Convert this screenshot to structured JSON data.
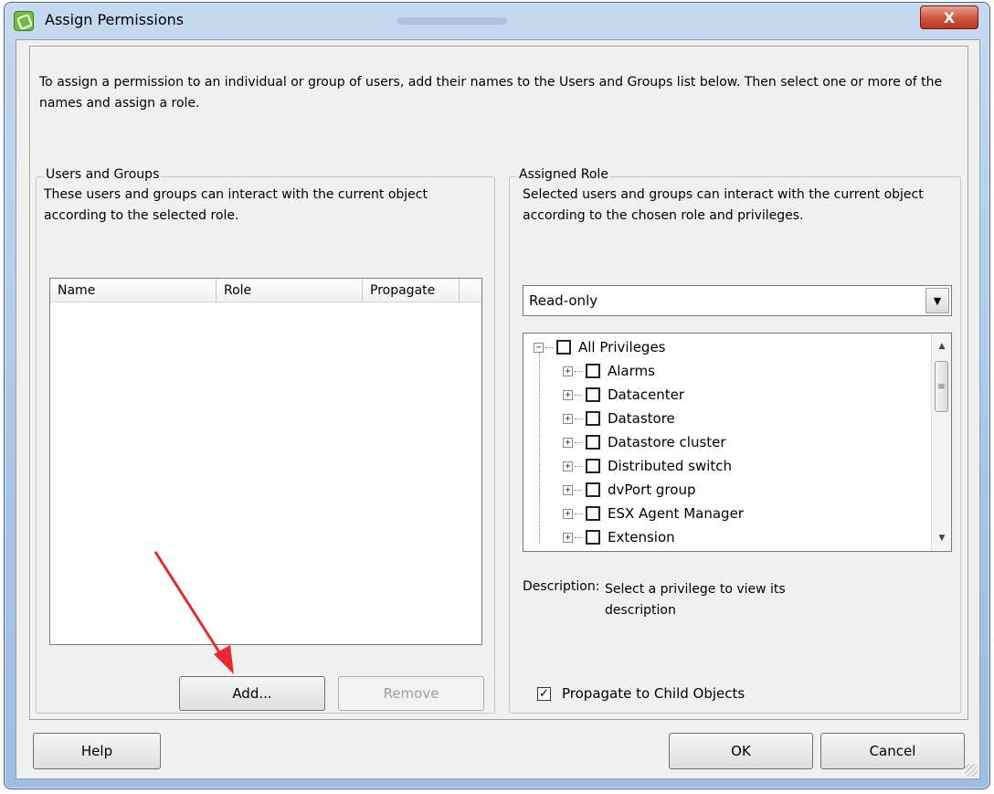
{
  "window": {
    "title": "Assign Permissions",
    "close_label": "X"
  },
  "intro": "To assign a permission to an individual or group of users, add their names to the Users and Groups list below. Then select one or more of the names and assign a role.",
  "users_groups": {
    "legend": "Users and Groups",
    "description": "These users and groups can interact with the current object according to the selected role.",
    "columns": [
      "Name",
      "Role",
      "Propagate"
    ],
    "add_label": "Add...",
    "remove_label": "Remove"
  },
  "assigned_role": {
    "legend": "Assigned Role",
    "description": "Selected users and groups can interact with the current object according to the chosen role and privileges.",
    "role_value": "Read-only",
    "privileges_root": "All Privileges",
    "privileges": [
      "Alarms",
      "Datacenter",
      "Datastore",
      "Datastore cluster",
      "Distributed switch",
      "dvPort group",
      "ESX Agent Manager",
      "Extension"
    ],
    "description_label": "Description:",
    "description_text": "Select a privilege to view its description",
    "propagate_label": "Propagate to Child Objects",
    "propagate_checked": true
  },
  "footer": {
    "help_label": "Help",
    "ok_label": "OK",
    "cancel_label": "Cancel"
  },
  "colors": {
    "annotation_arrow": "#e8292e",
    "title_bar": "#aac6e6",
    "close_button": "#d05a43"
  }
}
